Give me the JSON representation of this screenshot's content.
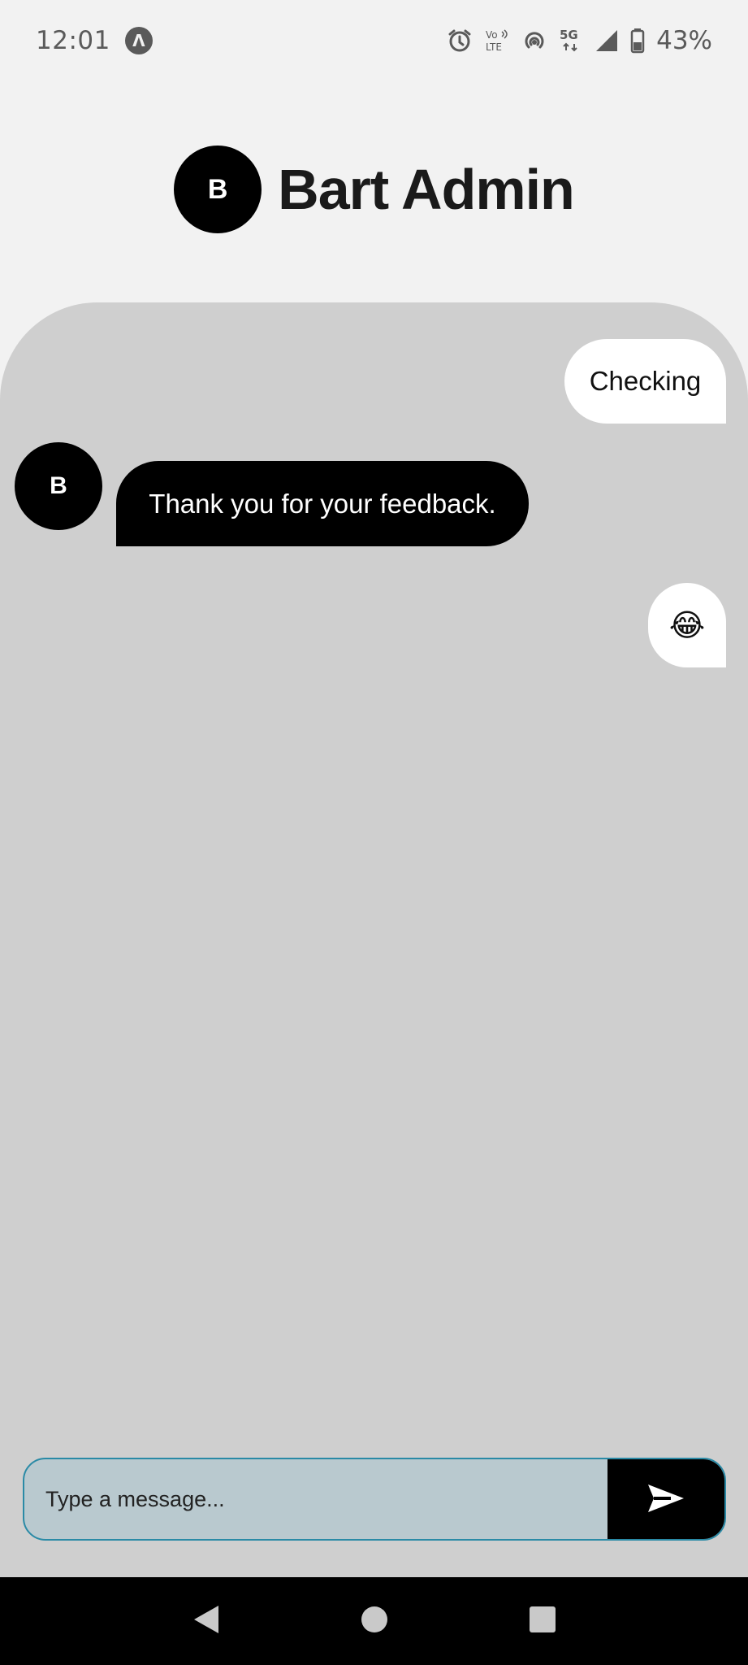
{
  "status_bar": {
    "time": "12:01",
    "app_badge_letter": "Λ",
    "battery_percent": "43%",
    "network_label": "5G",
    "icons": [
      "alarm-icon",
      "volte-icon",
      "hotspot-icon",
      "5g-icon",
      "signal-icon",
      "battery-icon"
    ]
  },
  "header": {
    "avatar_letter": "B",
    "title": "Bart Admin"
  },
  "messages": [
    {
      "direction": "outgoing",
      "text": "Checking"
    },
    {
      "direction": "incoming",
      "avatar_letter": "B",
      "text": "Thank you for your feedback."
    },
    {
      "direction": "outgoing",
      "text": "😂"
    }
  ],
  "composer": {
    "placeholder": "Type a message...",
    "value": ""
  },
  "colors": {
    "panel_bg": "#cfcfcf",
    "page_bg": "#f2f2f2",
    "input_bg": "#b9c9cf",
    "input_border": "#2a8aa6",
    "incoming_bubble": "#000000",
    "outgoing_bubble": "#ffffff"
  },
  "nav": {
    "icons": [
      "back-icon",
      "home-icon",
      "recents-icon"
    ]
  }
}
